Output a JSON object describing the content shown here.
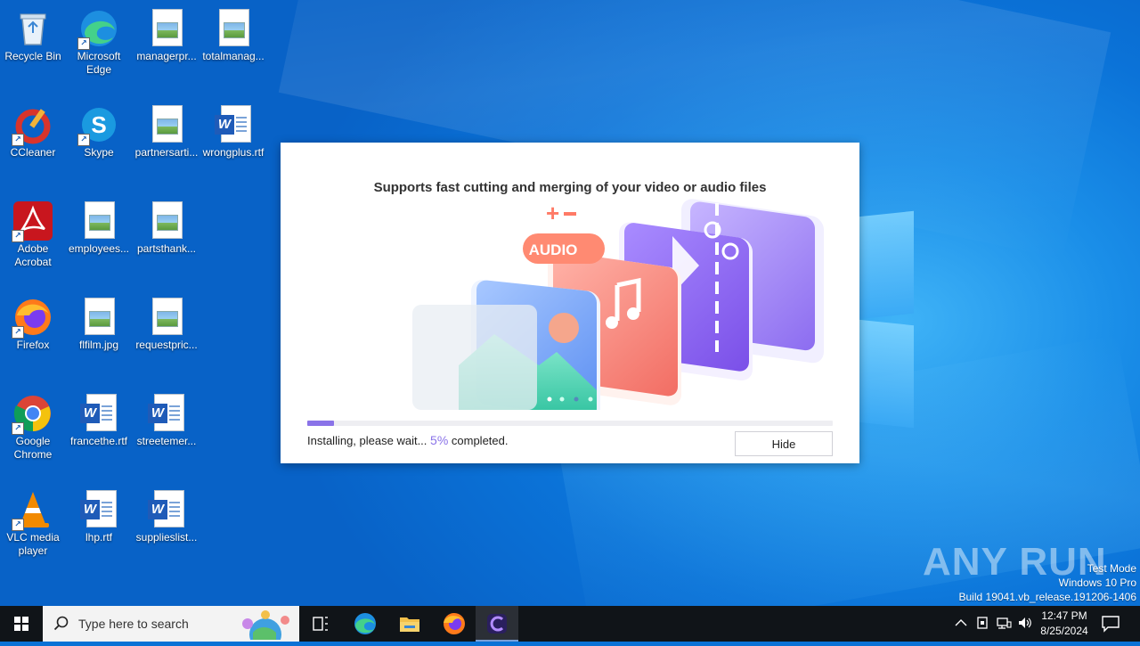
{
  "desktop": {
    "icons": [
      {
        "label": "Recycle Bin",
        "icon": "recycle-bin-icon"
      },
      {
        "label": "Microsoft Edge",
        "icon": "edge-icon"
      },
      {
        "label": "managerpr...",
        "icon": "image-file-icon"
      },
      {
        "label": "totalmanag...",
        "icon": "image-file-icon"
      },
      {
        "label": "CCleaner",
        "icon": "ccleaner-icon"
      },
      {
        "label": "Skype",
        "icon": "skype-icon"
      },
      {
        "label": "partnersarti...",
        "icon": "image-file-icon"
      },
      {
        "label": "wrongplus.rtf",
        "icon": "word-doc-icon"
      },
      {
        "label": "Adobe Acrobat",
        "icon": "acrobat-icon"
      },
      {
        "label": "employees...",
        "icon": "image-file-icon"
      },
      {
        "label": "partsthank...",
        "icon": "image-file-icon"
      },
      {
        "label": "Firefox",
        "icon": "firefox-icon"
      },
      {
        "label": "flfilm.jpg",
        "icon": "image-file-icon"
      },
      {
        "label": "requestpric...",
        "icon": "image-file-icon"
      },
      {
        "label": "Google Chrome",
        "icon": "chrome-icon"
      },
      {
        "label": "francethe.rtf",
        "icon": "word-doc-icon"
      },
      {
        "label": "streetemer...",
        "icon": "word-doc-icon"
      },
      {
        "label": "VLC media player",
        "icon": "vlc-icon"
      },
      {
        "label": "lhp.rtf",
        "icon": "word-doc-icon"
      },
      {
        "label": "supplieslist...",
        "icon": "word-doc-icon"
      }
    ]
  },
  "installer": {
    "headline": "Supports fast cutting and merging of your video or audio files",
    "audio_badge": "AUDIO",
    "status_prefix": "Installing, please wait...",
    "progress_percent": "5%",
    "progress_value": 0.05,
    "status_suffix": "completed.",
    "hide_label": "Hide",
    "accent_color": "#8a73e8"
  },
  "watermark": {
    "brand": "ANY RUN",
    "line1": "Test Mode",
    "line2": "Windows 10 Pro",
    "line3": "Build 19041.vb_release.191206-1406"
  },
  "taskbar": {
    "search_placeholder": "Type here to search",
    "apps": [
      "task-view-icon",
      "edge-icon",
      "file-explorer-icon",
      "firefox-icon",
      "installer-app-icon"
    ],
    "clock_time": "12:47 PM",
    "clock_date": "8/25/2024"
  }
}
